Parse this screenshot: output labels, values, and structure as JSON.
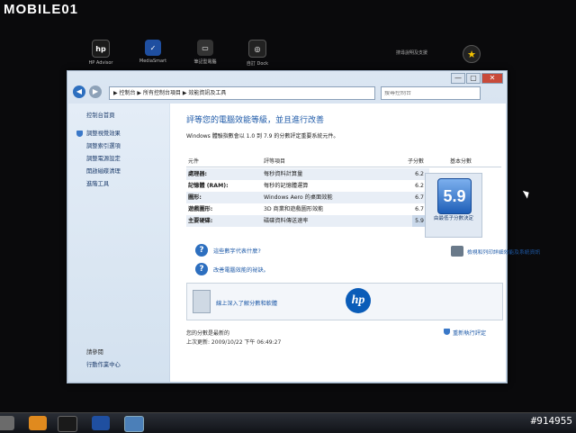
{
  "watermark": {
    "brand": "MOBILE01",
    "post_id": "#914955"
  },
  "dock": {
    "items": [
      {
        "label": "HP Advisor",
        "color": "#1a1a1a",
        "glyph": "hp"
      },
      {
        "label": "MediaSmart",
        "color": "#1f4fa0",
        "glyph": "✓"
      },
      {
        "label": "筆記型電腦",
        "color": "#333333",
        "glyph": "▭"
      },
      {
        "label": "自訂 Dock",
        "color": "#222222",
        "glyph": "◎"
      }
    ],
    "right_text": "搜尋說明及支援"
  },
  "window": {
    "address": "▶ 控制台 ▶ 所有控制台項目 ▶ 效能資訊及工具",
    "search_placeholder": "搜尋控制台",
    "help": "?",
    "buttons": {
      "minimize": "—",
      "maximize": "▢",
      "close": "✕"
    }
  },
  "sidebar": {
    "home": "控制台首頁",
    "items": [
      "調整視覺效果",
      "調整索引選項",
      "調整電源設定",
      "開啟磁碟清理",
      "進階工具"
    ],
    "see_also_title": "請參閱",
    "see_also": [
      "行動作業中心"
    ]
  },
  "main": {
    "title": "評等您的電腦效能等級，並且進行改善",
    "description": "Windows 體驗指數會以 1.0 到 7.9 的分數評定重要系統元件。",
    "headers": {
      "component": "元件",
      "rated": "評等項目",
      "subscore": "子分數",
      "base": "基本分數"
    },
    "rows": [
      {
        "component": "處理器:",
        "rated": "每秒資料計算量",
        "score": "6.2"
      },
      {
        "component": "記憶體 (RAM):",
        "rated": "每秒的記憶體運算",
        "score": "6.2"
      },
      {
        "component": "圖形:",
        "rated": "Windows Aero 的桌面效能",
        "score": "6.7"
      },
      {
        "component": "遊戲圖形:",
        "rated": "3D 商業和遊戲圖形效能",
        "score": "6.7"
      },
      {
        "component": "主要硬碟:",
        "rated": "磁碟資料傳送速率",
        "score": "5.9"
      }
    ],
    "base_score": "5.9",
    "base_caption": "由最低子分數決定",
    "links": {
      "what_mean": "這些數字代表什麼?",
      "improve": "改善電腦效能的祕訣。",
      "print": "檢視和列印詳細效能及系統資訊",
      "learn_more": "線上深入了解分數和軟體"
    },
    "hp_logo": "hp",
    "footer": {
      "status": "您的分數是最新的",
      "last_update": "上次更新: 2009/10/22 下午 06:49:27",
      "rerun": "重新執行評定"
    }
  }
}
